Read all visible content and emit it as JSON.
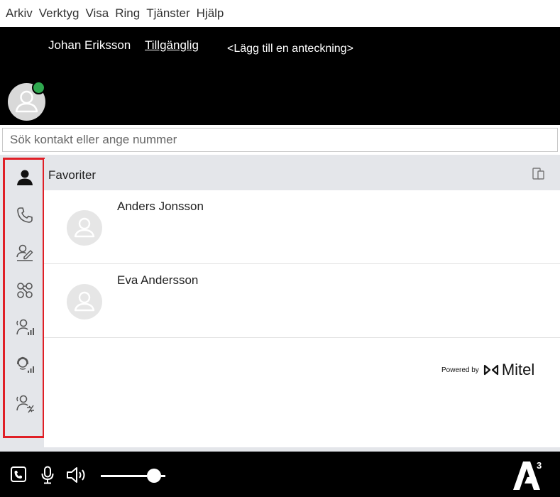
{
  "menu": [
    {
      "label": "Arkiv"
    },
    {
      "label": "Verktyg"
    },
    {
      "label": "Visa"
    },
    {
      "label": "Ring"
    },
    {
      "label": "Tjänster"
    },
    {
      "label": "Hjälp"
    }
  ],
  "user": {
    "name": "Johan Eriksson",
    "status": "Tillgänglig",
    "note": "<Lägg till en anteckning>",
    "presence_color": "#2fa84f"
  },
  "search": {
    "placeholder": "Sök kontakt eller ange nummer"
  },
  "sidebar": {
    "highlight_color": "#e01f26",
    "items": [
      {
        "icon": "contacts-icon",
        "active": true
      },
      {
        "icon": "phone-icon",
        "active": false
      },
      {
        "icon": "person-edit-icon",
        "active": false
      },
      {
        "icon": "network-icon",
        "active": false
      },
      {
        "icon": "person-signal-icon",
        "active": false
      },
      {
        "icon": "headset-signal-icon",
        "active": false
      },
      {
        "icon": "person-transfer-icon",
        "active": false
      }
    ]
  },
  "favorites": {
    "title": "Favoriter",
    "contacts": [
      {
        "name": "Anders Jonsson"
      },
      {
        "name": "Eva Andersson"
      }
    ]
  },
  "branding": {
    "powered_by": "Powered by",
    "brand": "Mitel"
  },
  "bottombar": {
    "volume_level": 0.72
  }
}
